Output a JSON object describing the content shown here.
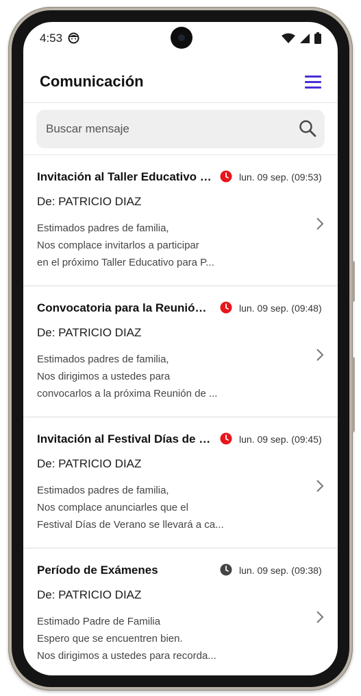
{
  "status_bar": {
    "time": "4:53"
  },
  "header": {
    "title": "Comunicación"
  },
  "search": {
    "placeholder": "Buscar mensaje"
  },
  "colors": {
    "accent": "#4b2fd6",
    "clock_unread": "#e8151b",
    "clock_read": "#444444"
  },
  "messages": [
    {
      "subject": "Invitación al Taller Educativo para Padres",
      "date": "lun. 09 sep. (09:53)",
      "from": "De: PATRICIO DIAZ",
      "preview": [
        "Estimados padres de familia,",
        "Nos complace invitarlos a participar",
        "en el próximo Taller Educativo para P..."
      ],
      "clock_icon": "clock-red-icon"
    },
    {
      "subject": "Convocatoria para la Reunión de Padres",
      "date": "lun. 09 sep. (09:48)",
      "from": "De: PATRICIO DIAZ",
      "preview": [
        "Estimados padres de familia,",
        "Nos dirigimos a ustedes para",
        "convocarlos a la próxima Reunión de ..."
      ],
      "clock_icon": "clock-red-icon"
    },
    {
      "subject": "Invitación al Festival Días de Verano",
      "date": "lun. 09 sep. (09:45)",
      "from": "De: PATRICIO DIAZ",
      "preview": [
        "Estimados padres de familia,",
        "Nos complace anunciarles que el",
        "Festival Días de Verano se llevará a ca..."
      ],
      "clock_icon": "clock-red-icon"
    },
    {
      "subject": "Período de Exámenes",
      "date": "lun. 09 sep. (09:38)",
      "from": "De: PATRICIO DIAZ",
      "preview": [
        "Estimado Padre de Familia",
        "Espero que se encuentren bien.",
        "Nos dirigimos a ustedes para recorda..."
      ],
      "clock_icon": "clock-gray-icon"
    }
  ]
}
